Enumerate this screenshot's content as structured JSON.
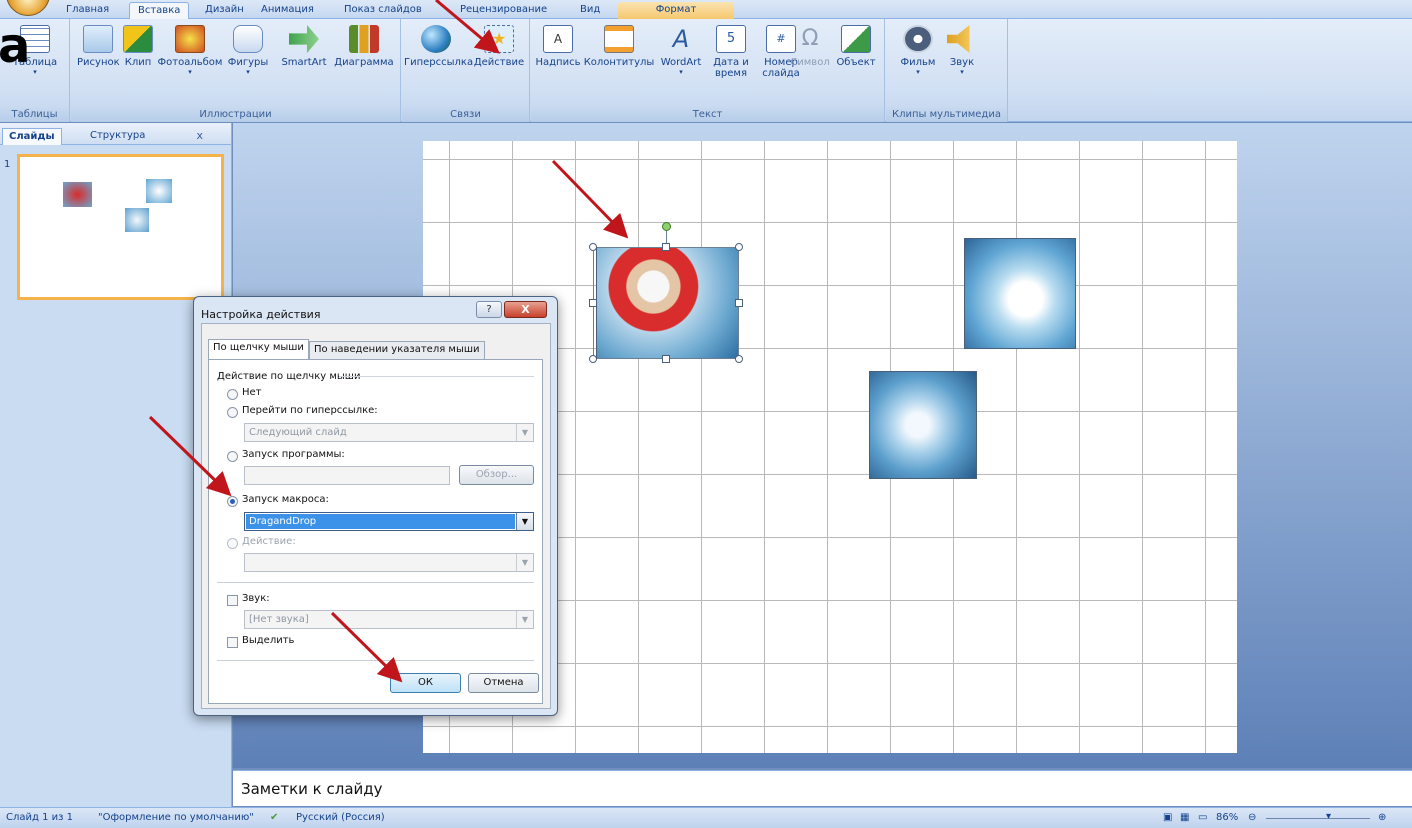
{
  "ribbon_tabs": [
    "Главная",
    "Вставка",
    "Дизайн",
    "Анимация",
    "Показ слайдов",
    "Рецензирование",
    "Вид",
    "Формат"
  ],
  "groups": {
    "tables": {
      "label": "Таблицы",
      "items": [
        "Таблица"
      ]
    },
    "illustrations": {
      "label": "Иллюстрации",
      "items": [
        "Рисунок",
        "Клип",
        "Фотоальбом",
        "Фигуры",
        "SmartArt",
        "Диаграмма"
      ]
    },
    "links": {
      "label": "Связи",
      "items": [
        "Гиперссылка",
        "Действие"
      ]
    },
    "text": {
      "label": "Текст",
      "items": [
        "Надпись",
        "Колонтитулы",
        "WordArt",
        "Дата и время",
        "Номер слайда",
        "Символ",
        "Объект"
      ]
    },
    "media": {
      "label": "Клипы мультимедиа",
      "items": [
        "Фильм",
        "Звук"
      ]
    }
  },
  "overlay_big_letter": "а",
  "slides_pane": {
    "tab_slides": "Слайды",
    "tab_outline": "Структура",
    "close": "x",
    "thumb_number": "1"
  },
  "notes_placeholder": "Заметки к слайду",
  "status": {
    "slide": "Слайд 1 из 1",
    "theme": "\"Оформление по умолчанию\"",
    "language": "Русский (Россия)",
    "zoom": "86%"
  },
  "dialog": {
    "title": "Настройка действия",
    "help": "?",
    "close": "X",
    "tab_click": "По щелчку мыши",
    "tab_hover": "По наведении указателя мыши",
    "group_label": "Действие по щелчку мыши",
    "opt_none": "Нет",
    "opt_hyperlink": "Перейти по гиперссылке:",
    "hyperlink_value": "Следующий слайд",
    "opt_program": "Запуск программы:",
    "browse": "Обзор...",
    "opt_macro": "Запуск макроса:",
    "macro_value": "DragandDrop",
    "opt_action": "Действие:",
    "sound_label": "Звук:",
    "sound_value": "[Нет звука]",
    "highlight_label": "Выделить",
    "ok": "ОК",
    "cancel": "Отмена"
  },
  "colors": {
    "accent_red_arrow": "#c0161b",
    "ribbon_blue": "#15428b",
    "office_orange": "#e9a73a"
  }
}
